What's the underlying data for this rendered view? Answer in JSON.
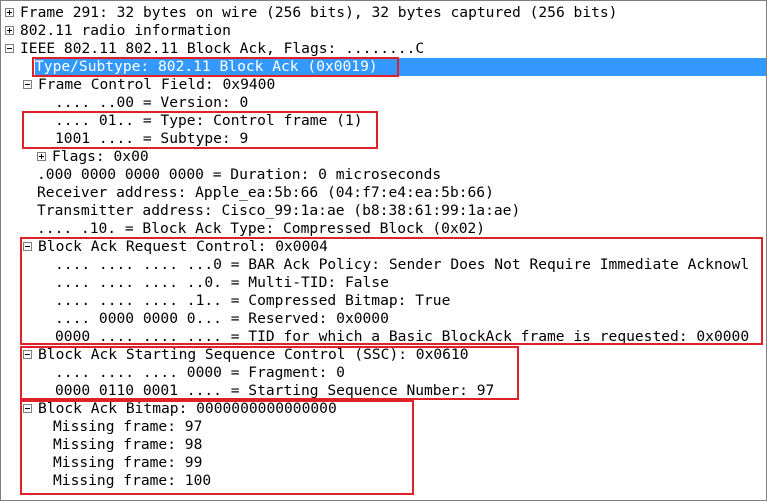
{
  "tree": {
    "frame": "Frame 291: 32 bytes on wire (256 bits), 32 bytes captured (256 bits)",
    "radio": "802.11 radio information",
    "ieee": "IEEE 802.11 802.11 Block Ack, Flags: ........C",
    "type_subtype": "Type/Subtype: 802.11 Block Ack (0x0019)",
    "fcf": "Frame Control Field: 0x9400",
    "version": ".... ..00 = Version: 0",
    "type": ".... 01.. = Type: Control frame (1)",
    "subtype": "1001 .... = Subtype: 9",
    "flags": "Flags: 0x00",
    "duration": ".000 0000 0000 0000 = Duration: 0 microseconds",
    "receiver": "Receiver address: Apple_ea:5b:66 (04:f7:e4:ea:5b:66)",
    "transmitter": "Transmitter address: Cisco_99:1a:ae (b8:38:61:99:1a:ae)",
    "ba_type": ".... .10. = Block Ack Type: Compressed Block (0x02)",
    "bar_control": "Block Ack Request Control: 0x0004",
    "bar_policy": ".... .... .... ...0 = BAR Ack Policy: Sender Does Not Require Immediate Acknowl",
    "multi_tid": ".... .... .... ..0. = Multi-TID: False",
    "compressed_bitmap": ".... .... .... .1.. = Compressed Bitmap: True",
    "reserved": ".... 0000 0000 0... = Reserved: 0x0000",
    "tid": "0000 .... .... .... = TID for which a Basic BlockAck frame is requested: 0x0000",
    "ssc": "Block Ack Starting Sequence Control (SSC): 0x0610",
    "fragment": ".... .... .... 0000 = Fragment: 0",
    "start_seq": "0000 0110 0001 .... = Starting Sequence Number: 97",
    "bitmap": "Block Ack Bitmap: 0000000000000000",
    "missing": [
      "Missing frame: 97",
      "Missing frame: 98",
      "Missing frame: 99",
      "Missing frame: 100"
    ]
  },
  "colors": {
    "selection": "#3399ff",
    "highlight_box": "#e0202a"
  }
}
